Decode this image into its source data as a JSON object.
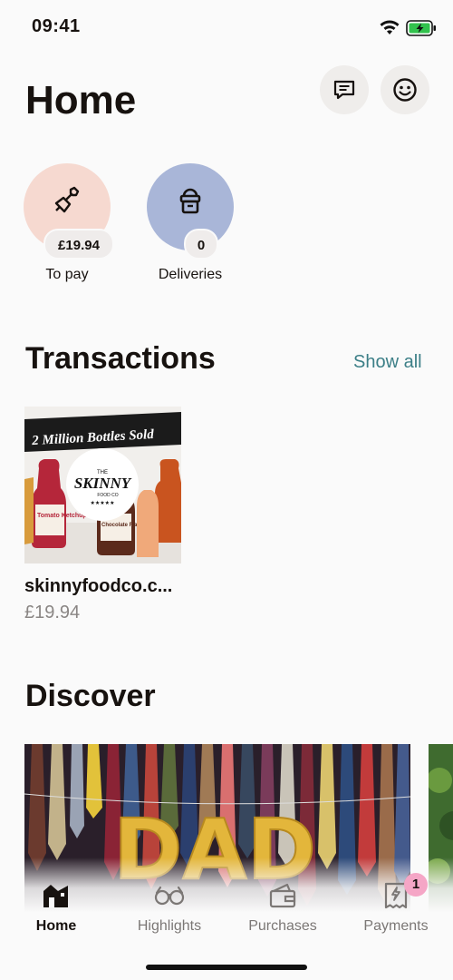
{
  "status": {
    "time": "09:41"
  },
  "header": {
    "title": "Home"
  },
  "shortcuts": [
    {
      "label": "To pay",
      "value": "£19.94",
      "color": "#f6d9d0"
    },
    {
      "label": "Deliveries",
      "value": "0",
      "color": "#a9b6d8"
    }
  ],
  "transactions": {
    "title": "Transactions",
    "show_all": "Show all",
    "items": [
      {
        "merchant": "skinnyfoodco.c...",
        "amount": "£19.94",
        "banner": "2 Million Bottles Sold",
        "logo_top": "THE",
        "logo_main": "SKINNY",
        "logo_sub": "FOOD CO",
        "bottle_1": "Tomato Ketchup",
        "bottle_2": "Chocolate Flavour"
      }
    ]
  },
  "discover": {
    "title": "Discover",
    "image_text": "DAD"
  },
  "tabbar": {
    "tabs": [
      {
        "label": "Home",
        "icon": "home-icon",
        "active": true
      },
      {
        "label": "Highlights",
        "icon": "glasses-icon",
        "active": false
      },
      {
        "label": "Purchases",
        "icon": "wallet-icon",
        "active": false
      },
      {
        "label": "Payments",
        "icon": "receipt-icon",
        "active": false,
        "badge": "1"
      }
    ]
  },
  "colors": {
    "accent": "#3c7f87",
    "badge": "#f5a6c6",
    "text": "#17120f",
    "muted": "#8a8684"
  }
}
